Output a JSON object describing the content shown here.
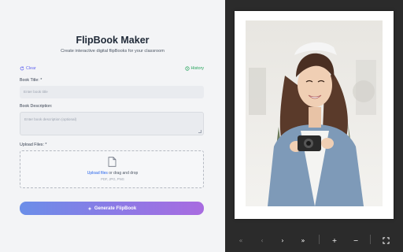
{
  "form": {
    "title": "FlipBook Maker",
    "subtitle": "Create interactive digital flipBooks for your classroom",
    "clear_label": "Clear",
    "history_label": "History",
    "book_title_label": "Book Title: *",
    "book_title_placeholder": "Enter book title",
    "book_desc_label": "Book Description:",
    "book_desc_placeholder": "Enter book description (optional)",
    "upload_label": "Upload Files: *",
    "upload_link": "Upload files",
    "upload_text": " or drag and drop",
    "upload_types": "PDF, JPG, PNG",
    "generate_label": "Generate FlipBook"
  },
  "viewer": {
    "controls": {
      "first": "«",
      "prev": "‹",
      "next": "›",
      "last": "»",
      "zoom_in": "+",
      "zoom_out": "−",
      "fullscreen": "⛶"
    }
  },
  "colors": {
    "accent": "#6366f1",
    "history": "#22a35a",
    "link": "#2563eb",
    "viewer_bg": "#2b2b2b"
  }
}
